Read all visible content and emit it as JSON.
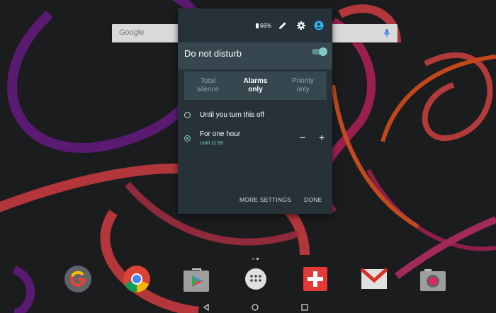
{
  "search": {
    "logo_text": "Google",
    "mic": "mic-icon"
  },
  "status": {
    "battery": "66%",
    "icons": [
      "edit-icon",
      "settings-icon",
      "user-icon"
    ]
  },
  "dnd": {
    "title": "Do not disturb",
    "enabled": true,
    "tabs": [
      {
        "line1": "Total",
        "line2": "silence",
        "active": false
      },
      {
        "line1": "Alarms",
        "line2": "only",
        "active": true
      },
      {
        "line1": "Priority",
        "line2": "only",
        "active": false
      }
    ],
    "options": [
      {
        "label": "Until you turn this off",
        "selected": false
      },
      {
        "label": "For one hour",
        "sub": "Until 11:56",
        "selected": true
      }
    ],
    "minus": "−",
    "plus": "+",
    "more_settings": "MORE SETTINGS",
    "done": "DONE"
  },
  "dock": {
    "apps": [
      "google-app",
      "chrome",
      "play-store",
      "app-drawer",
      "plus-app",
      "gmail",
      "camera"
    ]
  },
  "nav": {
    "buttons": [
      "back",
      "home",
      "recents"
    ]
  },
  "colors": {
    "accent": "#80cbc4",
    "panel": "#263238",
    "header": "#37474f"
  }
}
